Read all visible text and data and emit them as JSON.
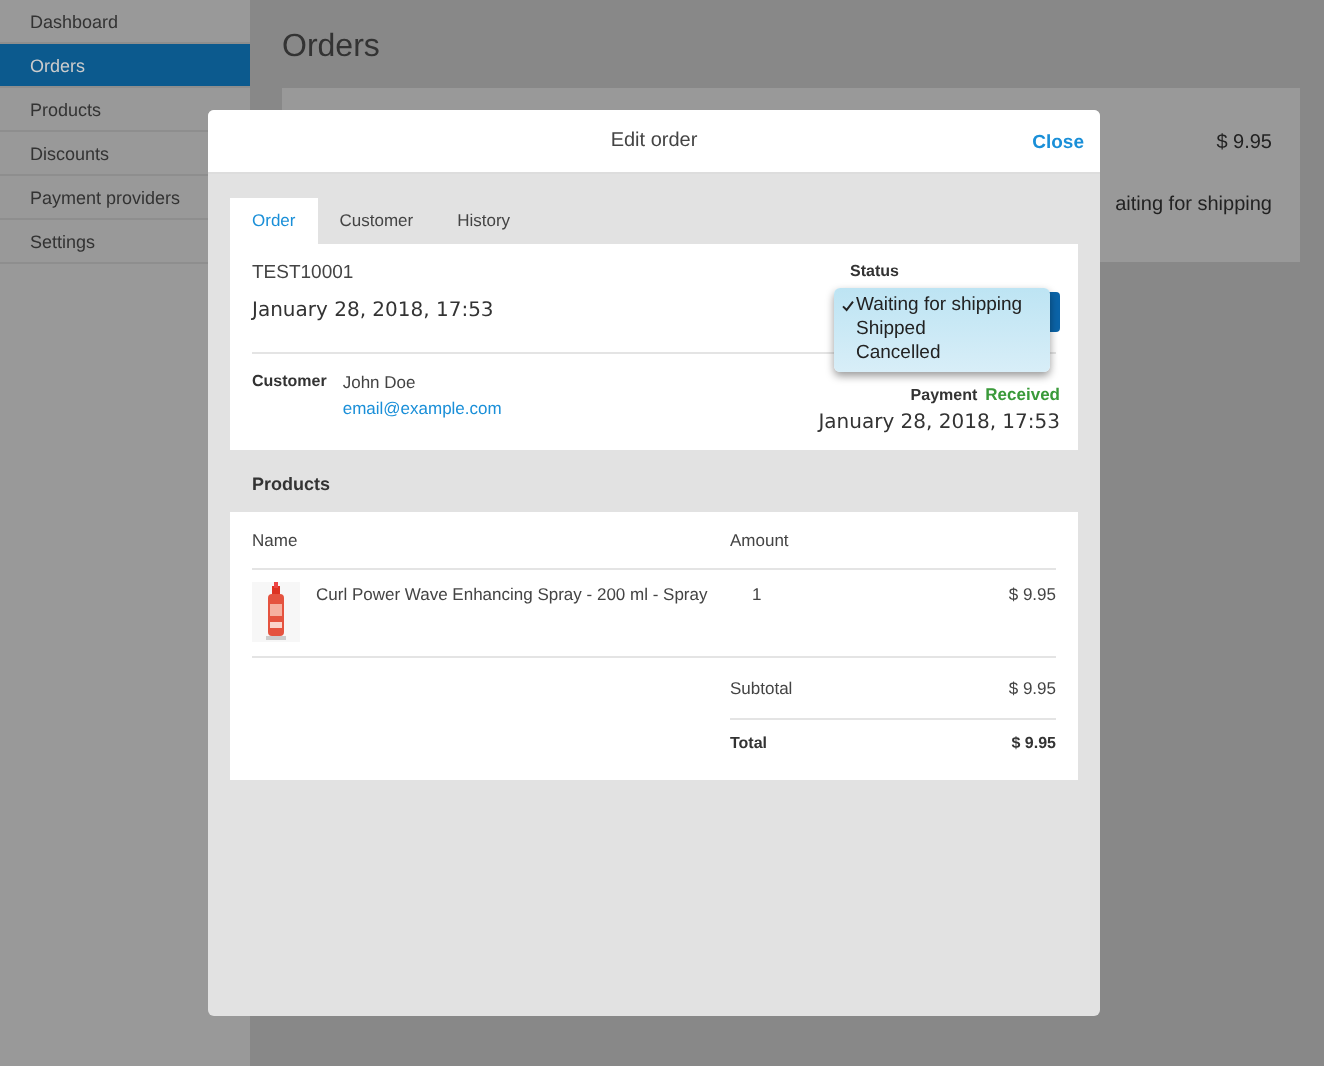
{
  "sidebar": {
    "items": [
      {
        "label": "Dashboard",
        "selected": false
      },
      {
        "label": "Orders",
        "selected": true
      },
      {
        "label": "Products",
        "selected": false
      },
      {
        "label": "Discounts",
        "selected": false
      },
      {
        "label": "Payment providers",
        "selected": false
      },
      {
        "label": "Settings",
        "selected": false
      }
    ]
  },
  "page": {
    "title": "Orders",
    "order_row": {
      "price": "$ 9.95",
      "status": "aiting for shipping"
    }
  },
  "modal": {
    "title": "Edit order",
    "close": "Close",
    "tabs": [
      {
        "label": "Order",
        "selected": true
      },
      {
        "label": "Customer",
        "selected": false
      },
      {
        "label": "History",
        "selected": false
      }
    ],
    "order": {
      "number": "TEST10001",
      "date": "January 28, 2018, 17:53",
      "status_label": "Status",
      "status_options": [
        {
          "label": "Waiting for shipping",
          "selected": true
        },
        {
          "label": "Shipped",
          "selected": false
        },
        {
          "label": "Cancelled",
          "selected": false
        }
      ],
      "customer_label": "Customer",
      "customer_name": "John Doe",
      "customer_email": "email@example.com",
      "payment_label": "Payment",
      "payment_status": "Received",
      "payment_date": "January 28, 2018, 17:53"
    },
    "products": {
      "heading": "Products",
      "columns": [
        "Name",
        "Amount"
      ],
      "rows": [
        {
          "kind": "picture",
          "name": "Curl Power Wave Enhancing Spray - 200 ml - Spray",
          "amount": "1",
          "price": "$ 9.95"
        }
      ],
      "subtotal_label": "Subtotal",
      "subtotal": "$ 9.95",
      "total_label": "Total",
      "total": "$ 9.95"
    }
  }
}
